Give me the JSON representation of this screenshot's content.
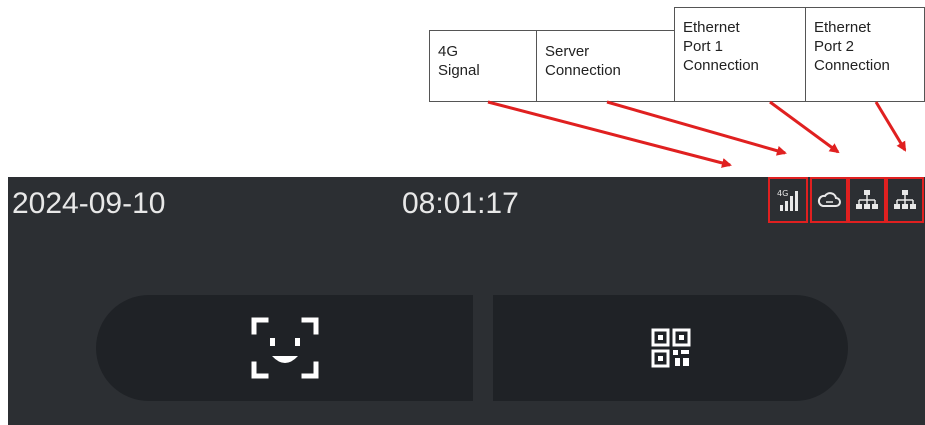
{
  "annotations": {
    "signal_4g": "4G\nSignal",
    "server_connection": "Server\nConnection",
    "ethernet_port_1": "Ethernet\nPort 1\nConnection",
    "ethernet_port_2": "Ethernet\nPort 2\nConnection",
    "arrow_color": "#e02020"
  },
  "screen": {
    "date": "2024-09-10",
    "time": "08:01:17",
    "background": "#2c2f33",
    "text_color": "#e8e8e8",
    "status_icons": [
      "signal-bars-icon",
      "cloud-icon",
      "network-icon",
      "network-icon"
    ],
    "highlight_color": "#e02020"
  },
  "actions": {
    "buttons": [
      "face-scan-icon",
      "qr-code-icon"
    ],
    "button_background": "#1f2226"
  }
}
